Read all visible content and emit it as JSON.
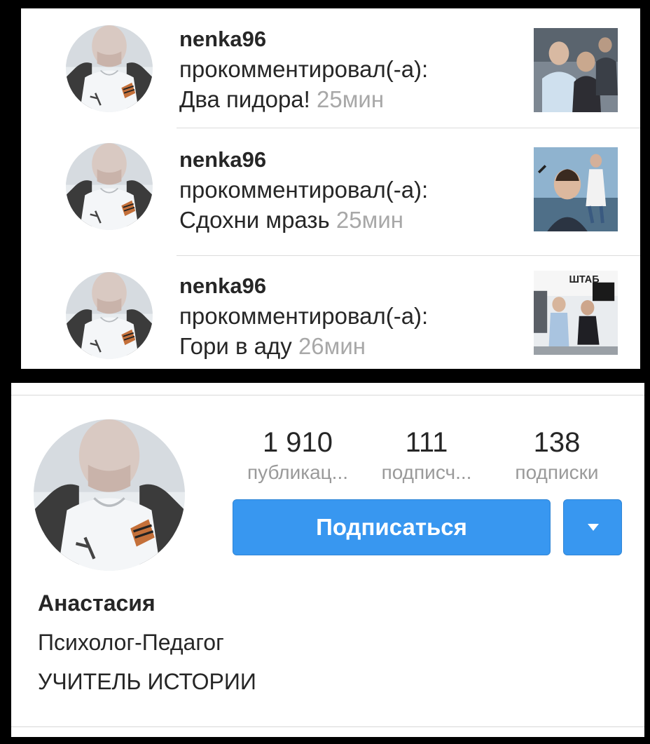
{
  "notifications": [
    {
      "username": "nenka96",
      "action": "прокомментировал(-а):",
      "comment": "Два пидора!",
      "time": "25мин",
      "avatar_icon": "user-avatar-photo",
      "thumbnail_icon": "post-thumbnail-photo"
    },
    {
      "username": "nenka96",
      "action": "прокомментировал(-а):",
      "comment": "Сдохни мразь",
      "time": "25мин",
      "avatar_icon": "user-avatar-photo",
      "thumbnail_icon": "post-thumbnail-photo"
    },
    {
      "username": "nenka96",
      "action": "прокомментировал(-а):",
      "comment": "Гори в аду",
      "time": "26мин",
      "avatar_icon": "user-avatar-photo",
      "thumbnail_icon": "post-thumbnail-photo",
      "thumbnail_text": "ШТАБ"
    }
  ],
  "profile": {
    "stats": [
      {
        "value": "1 910",
        "label": "публикац..."
      },
      {
        "value": "111",
        "label": "подписч..."
      },
      {
        "value": "138",
        "label": "подписки"
      }
    ],
    "follow_label": "Подписаться",
    "name": "Анастасия",
    "bio_lines": [
      "Психолог-Педагог",
      "УЧИТЕЛЬ ИСТОРИИ"
    ]
  },
  "colors": {
    "accent": "#3897f0",
    "secondary_text": "#9a9a9a",
    "primary_text": "#262626"
  }
}
